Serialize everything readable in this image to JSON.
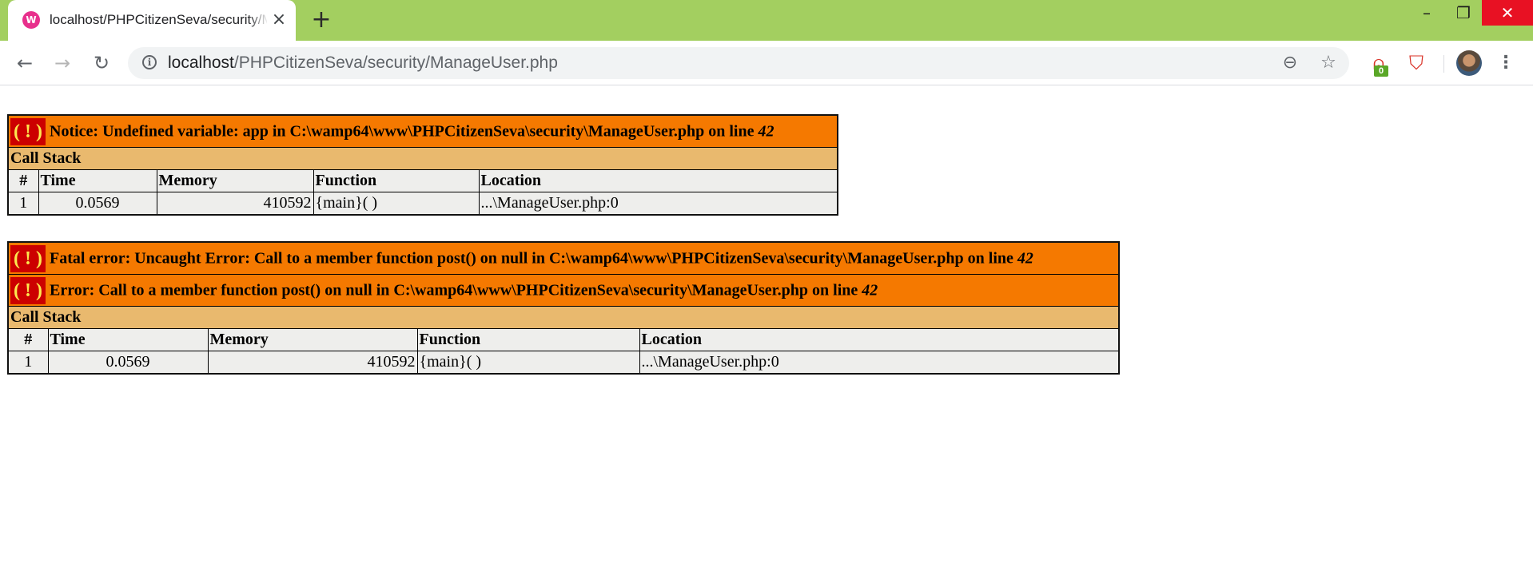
{
  "browser": {
    "tab": {
      "title": "localhost/PHPCitizenSeva/security/ManageUser.php",
      "favicon": "wamp-icon"
    },
    "address": {
      "host": "localhost",
      "path": "/PHPCitizenSeva/security/ManageUser.php"
    },
    "extension_badge": "0",
    "theme_color": "#a3cf60"
  },
  "notice": {
    "message": "Notice: Undefined variable: app in C:\\wamp64\\www\\PHPCitizenSeva\\security\\ManageUser.php on line ",
    "line": "42",
    "call_stack_label": "Call Stack",
    "columns": [
      "#",
      "Time",
      "Memory",
      "Function",
      "Location"
    ],
    "rows": [
      {
        "num": "1",
        "time": "0.0569",
        "memory": "410592",
        "function": "{main}( )",
        "location": "...\\ManageUser.php:0"
      }
    ]
  },
  "fatal": {
    "message1": "Fatal error: Uncaught Error: Call to a member function post() on null in C:\\wamp64\\www\\PHPCitizenSeva\\security\\ManageUser.php on line ",
    "line1": "42",
    "message2": "Error: Call to a member function post() on null in C:\\wamp64\\www\\PHPCitizenSeva\\security\\ManageUser.php on line ",
    "line2": "42",
    "call_stack_label": "Call Stack",
    "columns": [
      "#",
      "Time",
      "Memory",
      "Function",
      "Location"
    ],
    "rows": [
      {
        "num": "1",
        "time": "0.0569",
        "memory": "410592",
        "function": "{main}( )",
        "location": "...\\ManageUser.php:0"
      }
    ]
  },
  "colors": {
    "error_header": "#f57900",
    "error_badge": "#cc0000",
    "error_badge_glyph": "#fce94f",
    "call_stack_header": "#e9b96e",
    "table_cell": "#eeeeec"
  },
  "badge_glyph": "( ! )"
}
